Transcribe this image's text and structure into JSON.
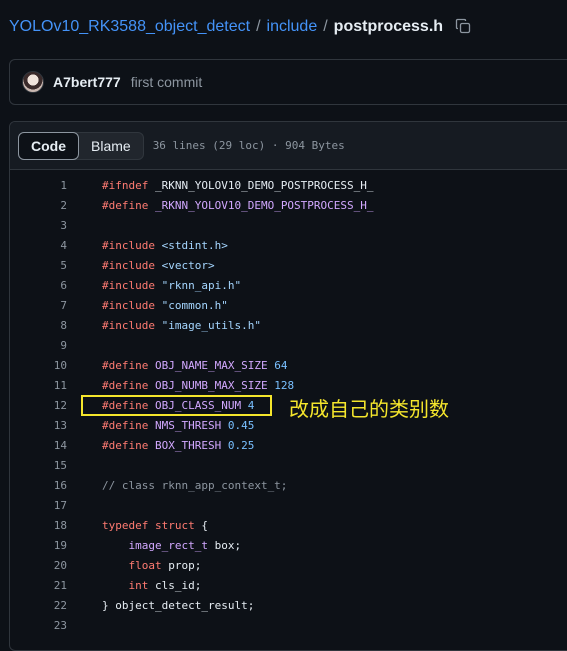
{
  "breadcrumb": {
    "repo": "YOLOv10_RK3588_object_detect",
    "sep": "/",
    "folder": "include",
    "file": "postprocess.h"
  },
  "commit": {
    "author": "A7bert777",
    "message": "first commit"
  },
  "file_header": {
    "code_tab": "Code",
    "blame_tab": "Blame",
    "info": "36 lines (29 loc) · 904 Bytes"
  },
  "code_lines": [
    {
      "n": "1",
      "t": [
        {
          "c": "kw",
          "s": "#ifndef"
        },
        {
          "c": "",
          "s": " _RKNN_YOLOV10_DEMO_POSTPROCESS_H_"
        }
      ]
    },
    {
      "n": "2",
      "t": [
        {
          "c": "kw",
          "s": "#define"
        },
        {
          "c": "",
          "s": " "
        },
        {
          "c": "ent",
          "s": "_RKNN_YOLOV10_DEMO_POSTPROCESS_H_"
        }
      ]
    },
    {
      "n": "3",
      "t": []
    },
    {
      "n": "4",
      "t": [
        {
          "c": "kw",
          "s": "#include"
        },
        {
          "c": "",
          "s": " "
        },
        {
          "c": "str",
          "s": "<stdint.h>"
        }
      ]
    },
    {
      "n": "5",
      "t": [
        {
          "c": "kw",
          "s": "#include"
        },
        {
          "c": "",
          "s": " "
        },
        {
          "c": "str",
          "s": "<vector>"
        }
      ]
    },
    {
      "n": "6",
      "t": [
        {
          "c": "kw",
          "s": "#include"
        },
        {
          "c": "",
          "s": " "
        },
        {
          "c": "str",
          "s": "\"rknn_api.h\""
        }
      ]
    },
    {
      "n": "7",
      "t": [
        {
          "c": "kw",
          "s": "#include"
        },
        {
          "c": "",
          "s": " "
        },
        {
          "c": "str",
          "s": "\"common.h\""
        }
      ]
    },
    {
      "n": "8",
      "t": [
        {
          "c": "kw",
          "s": "#include"
        },
        {
          "c": "",
          "s": " "
        },
        {
          "c": "str",
          "s": "\"image_utils.h\""
        }
      ]
    },
    {
      "n": "9",
      "t": []
    },
    {
      "n": "10",
      "t": [
        {
          "c": "kw",
          "s": "#define"
        },
        {
          "c": "",
          "s": " "
        },
        {
          "c": "ent",
          "s": "OBJ_NAME_MAX_SIZE"
        },
        {
          "c": "",
          "s": " "
        },
        {
          "c": "num",
          "s": "64"
        }
      ]
    },
    {
      "n": "11",
      "t": [
        {
          "c": "kw",
          "s": "#define"
        },
        {
          "c": "",
          "s": " "
        },
        {
          "c": "ent",
          "s": "OBJ_NUMB_MAX_SIZE"
        },
        {
          "c": "",
          "s": " "
        },
        {
          "c": "num",
          "s": "128"
        }
      ]
    },
    {
      "n": "12",
      "t": [
        {
          "c": "kw",
          "s": "#define"
        },
        {
          "c": "",
          "s": " "
        },
        {
          "c": "ent",
          "s": "OBJ_CLASS_NUM"
        },
        {
          "c": "",
          "s": " "
        },
        {
          "c": "num",
          "s": "4"
        }
      ]
    },
    {
      "n": "13",
      "t": [
        {
          "c": "kw",
          "s": "#define"
        },
        {
          "c": "",
          "s": " "
        },
        {
          "c": "ent",
          "s": "NMS_THRESH"
        },
        {
          "c": "",
          "s": " "
        },
        {
          "c": "num",
          "s": "0.45"
        }
      ]
    },
    {
      "n": "14",
      "t": [
        {
          "c": "kw",
          "s": "#define"
        },
        {
          "c": "",
          "s": " "
        },
        {
          "c": "ent",
          "s": "BOX_THRESH"
        },
        {
          "c": "",
          "s": " "
        },
        {
          "c": "num",
          "s": "0.25"
        }
      ]
    },
    {
      "n": "15",
      "t": []
    },
    {
      "n": "16",
      "t": [
        {
          "c": "cmt",
          "s": "// class rknn_app_context_t;"
        }
      ]
    },
    {
      "n": "17",
      "t": []
    },
    {
      "n": "18",
      "t": [
        {
          "c": "kw",
          "s": "typedef"
        },
        {
          "c": "",
          "s": " "
        },
        {
          "c": "kw",
          "s": "struct"
        },
        {
          "c": "",
          "s": " {"
        }
      ]
    },
    {
      "n": "19",
      "t": [
        {
          "c": "",
          "s": "    "
        },
        {
          "c": "ent",
          "s": "image_rect_t"
        },
        {
          "c": "",
          "s": " box;"
        }
      ]
    },
    {
      "n": "20",
      "t": [
        {
          "c": "",
          "s": "    "
        },
        {
          "c": "kw",
          "s": "float"
        },
        {
          "c": "",
          "s": " prop;"
        }
      ]
    },
    {
      "n": "21",
      "t": [
        {
          "c": "",
          "s": "    "
        },
        {
          "c": "kw",
          "s": "int"
        },
        {
          "c": "",
          "s": " cls_id;"
        }
      ]
    },
    {
      "n": "22",
      "t": [
        {
          "c": "",
          "s": "} object_detect_result;"
        }
      ]
    },
    {
      "n": "23",
      "t": []
    }
  ],
  "annotation": "改成自己的类别数",
  "colors": {
    "background": "#0d1117",
    "link": "#4493f8",
    "keyword": "#ff7b72",
    "string": "#a5d6ff",
    "number": "#79c0ff",
    "entity": "#d2a8ff",
    "annotation": "#f5e62c"
  },
  "icons": {
    "copy": "copy-path-icon"
  }
}
